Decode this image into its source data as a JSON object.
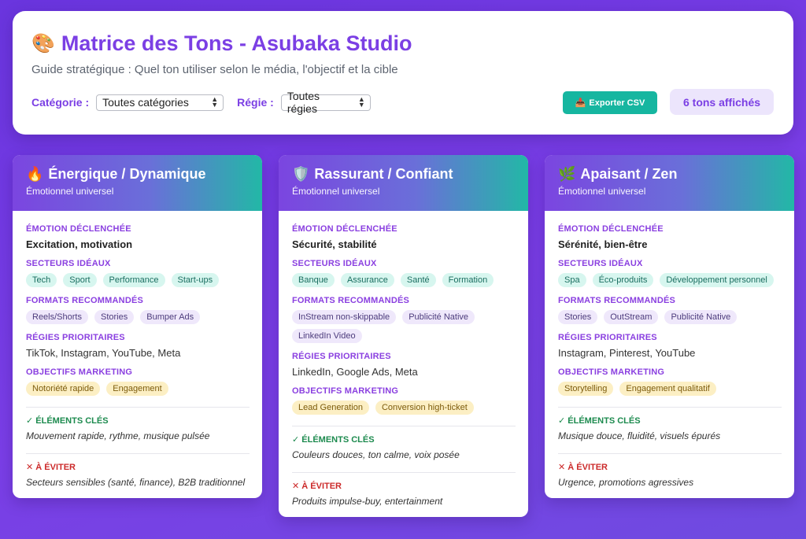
{
  "header": {
    "icon": "palette-icon",
    "title_emoji": "🎨",
    "title": "Matrice des Tons - Asubaka Studio",
    "subtitle": "Guide stratégique : Quel ton utiliser selon le média, l'objectif et la cible",
    "category_label": "Catégorie :",
    "category_value": "Toutes catégories",
    "regie_label": "Régie :",
    "regie_value": "Toutes régies",
    "export_icon": "inbox-tray-icon",
    "export_emoji": "📥",
    "export_label": "Exporter CSV",
    "count_text": "6 tons affichés"
  },
  "labels": {
    "emotion": "ÉMOTION DÉCLENCHÉE",
    "secteurs": "SECTEURS IDÉAUX",
    "formats": "FORMATS RECOMMANDÉS",
    "regies": "RÉGIES PRIORITAIRES",
    "objectifs": "OBJECTIFS MARKETING",
    "elements": "✓ ÉLÉMENTS CLÉS",
    "eviter": "✕ À ÉVITER"
  },
  "colors": {
    "accent": "#7b3fe4",
    "export_button": "#16b6a0",
    "card_gradient_start": "#7b45e0",
    "card_gradient_end": "#22b8a6"
  },
  "cards": [
    {
      "icon": "fire-icon",
      "emoji": "🔥",
      "title": "Énergique / Dynamique",
      "subtitle": "Émotionnel universel",
      "emotion": "Excitation, motivation",
      "secteurs": [
        "Tech",
        "Sport",
        "Performance",
        "Start-ups"
      ],
      "formats": [
        "Reels/Shorts",
        "Stories",
        "Bumper Ads"
      ],
      "regies": "TikTok, Instagram, YouTube, Meta",
      "objectifs": [
        "Notoriété rapide",
        "Engagement"
      ],
      "elements": "Mouvement rapide, rythme, musique pulsée",
      "eviter": "Secteurs sensibles (santé, finance), B2B traditionnel"
    },
    {
      "icon": "shield-icon",
      "emoji": "🛡️",
      "title": "Rassurant / Confiant",
      "subtitle": "Émotionnel universel",
      "emotion": "Sécurité, stabilité",
      "secteurs": [
        "Banque",
        "Assurance",
        "Santé",
        "Formation"
      ],
      "formats": [
        "InStream non-skippable",
        "Publicité Native",
        "LinkedIn Video"
      ],
      "regies": "LinkedIn, Google Ads, Meta",
      "objectifs": [
        "Lead Generation",
        "Conversion high-ticket"
      ],
      "elements": "Couleurs douces, ton calme, voix posée",
      "eviter": "Produits impulse-buy, entertainment"
    },
    {
      "icon": "herb-icon",
      "emoji": "🌿",
      "title": "Apaisant / Zen",
      "subtitle": "Émotionnel universel",
      "emotion": "Sérénité, bien-être",
      "secteurs": [
        "Spa",
        "Éco-produits",
        "Développement personnel"
      ],
      "formats": [
        "Stories",
        "OutStream",
        "Publicité Native"
      ],
      "regies": "Instagram, Pinterest, YouTube",
      "objectifs": [
        "Storytelling",
        "Engagement qualitatif"
      ],
      "elements": "Musique douce, fluidité, visuels épurés",
      "eviter": "Urgence, promotions agressives"
    }
  ]
}
